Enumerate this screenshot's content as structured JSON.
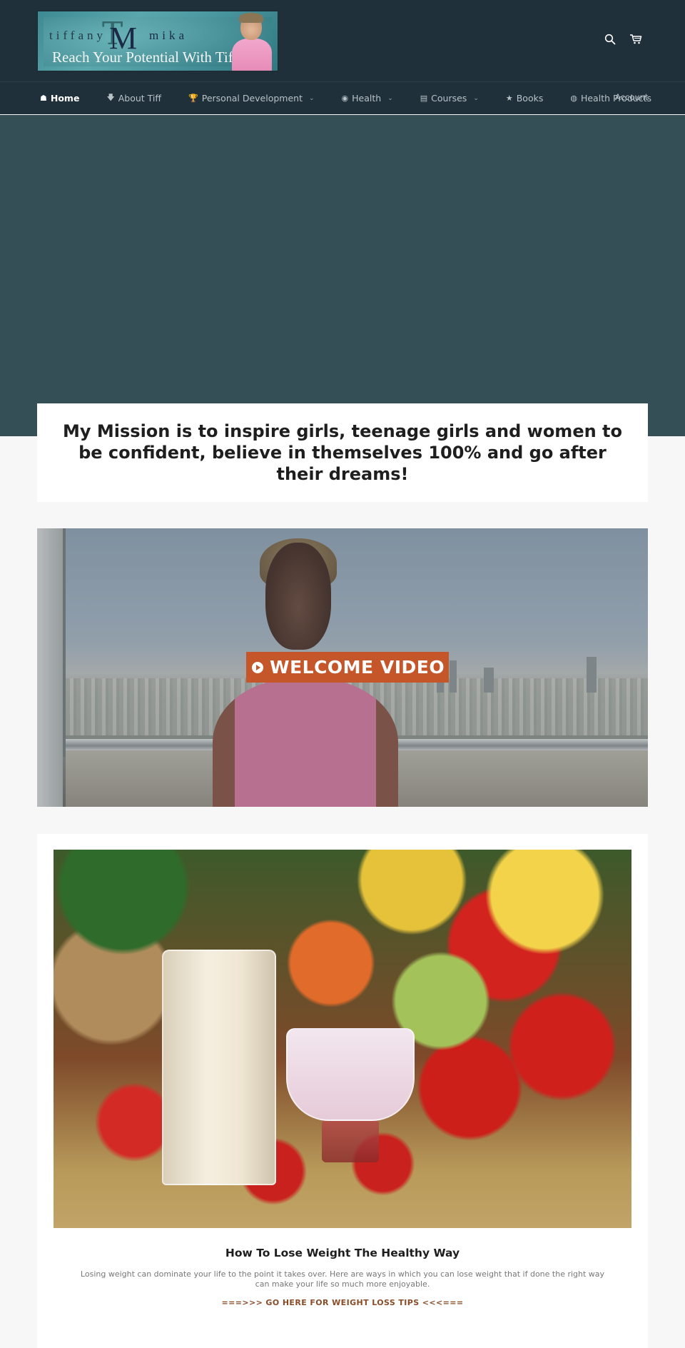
{
  "header": {
    "logo": {
      "name_left": "tiffany",
      "monogram_t": "T",
      "monogram_m": "M",
      "name_right": "mika",
      "tagline": "Reach Your Potential With Tiff"
    },
    "icons": [
      "search-icon",
      "cart-icon"
    ]
  },
  "nav": {
    "items": [
      {
        "icon": "☗",
        "icon_name": "home-icon",
        "label": "Home",
        "active": true,
        "dropdown": false
      },
      {
        "icon": "🡇",
        "icon_name": "arrow-down-icon",
        "label": "About Tiff",
        "active": false,
        "dropdown": false
      },
      {
        "icon": "🏆",
        "icon_name": "trophy-icon",
        "label": "Personal Development",
        "active": false,
        "dropdown": true
      },
      {
        "icon": "◉",
        "icon_name": "target-icon",
        "label": "Health",
        "active": false,
        "dropdown": true
      },
      {
        "icon": "▤",
        "icon_name": "book-icon",
        "label": "Courses",
        "active": false,
        "dropdown": true
      },
      {
        "icon": "★",
        "icon_name": "star-icon",
        "label": "Books",
        "active": false,
        "dropdown": false
      },
      {
        "icon": "◍",
        "icon_name": "globe-icon",
        "label": "Health Products",
        "active": false,
        "dropdown": false
      }
    ],
    "chevron": "⌄",
    "account_label": "Account"
  },
  "hero": {
    "mission": "My Mission is to inspire girls, teenage girls and women to be confident, believe in themselves 100% and go after their dreams!"
  },
  "video": {
    "label": "WELCOME VIDEO",
    "accent_color": "#c4562a"
  },
  "article": {
    "title": "How To Lose Weight The Healthy Way",
    "excerpt": "Losing weight can dominate your life to the point it takes over. Here are ways in which you can lose weight that if done the right way can make your life so much more enjoyable.",
    "link": "===>>> GO HERE FOR WEIGHT LOSS TIPS <<<==="
  },
  "colors": {
    "header_bg": "#20303a",
    "hero_bg": "#354f57",
    "page_bg": "#f7f7f7",
    "link_color": "#8a4b26"
  }
}
